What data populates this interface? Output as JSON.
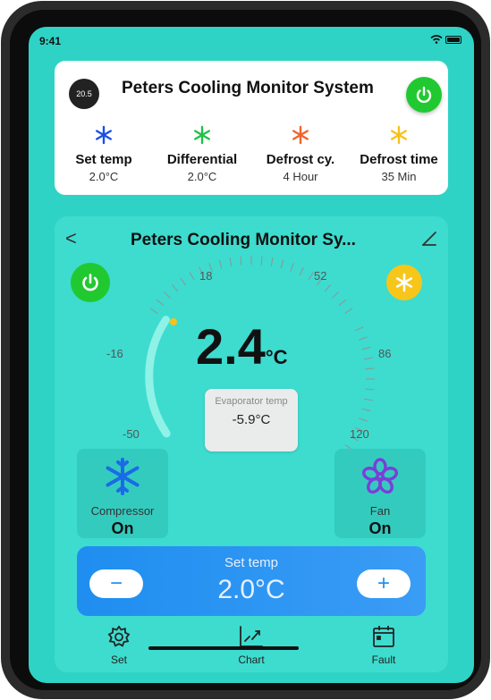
{
  "status_bar": {
    "time": "9:41"
  },
  "top_card": {
    "badge": "20.5",
    "title": "Peters Cooling Monitor System",
    "items": [
      {
        "label": "Set temp",
        "value": "2.0°C",
        "icon": "snowflake-blue-icon",
        "color": "#1a4fe6"
      },
      {
        "label": "Differential",
        "value": "2.0°C",
        "icon": "snowflake-green-icon",
        "color": "#22c04a"
      },
      {
        "label": "Defrost cy.",
        "value": "4 Hour",
        "icon": "snowflake-orange-icon",
        "color": "#f2642b"
      },
      {
        "label": "Defrost time",
        "value": "35 Min",
        "icon": "snowflake-yellow-icon",
        "color": "#f6c21a"
      }
    ]
  },
  "panel": {
    "back": "<",
    "title": "Peters Cooling Monitor Sy...",
    "gauge": {
      "ticks": [
        "18",
        "52",
        "-16",
        "86",
        "-50",
        "120"
      ],
      "temperature": "2.4",
      "unit": "°C",
      "range": [
        -50,
        120
      ]
    },
    "evaporator": {
      "label": "Evaporator temp",
      "value": "-5.9°C"
    },
    "compressor": {
      "label": "Compressor",
      "value": "On"
    },
    "fan": {
      "label": "Fan",
      "value": "On"
    },
    "set_temp": {
      "label": "Set temp",
      "value": "2.0°C",
      "minus": "−",
      "plus": "+"
    },
    "tabs": [
      {
        "label": "Set",
        "icon": "gear-icon"
      },
      {
        "label": "Chart",
        "icon": "chart-icon"
      },
      {
        "label": "Fault",
        "icon": "calendar-icon"
      }
    ]
  },
  "colors": {
    "accent": "#2fd3c6",
    "power": "#21c930",
    "snow": "#f6c61a",
    "set_bar": "#1f8ef0"
  }
}
